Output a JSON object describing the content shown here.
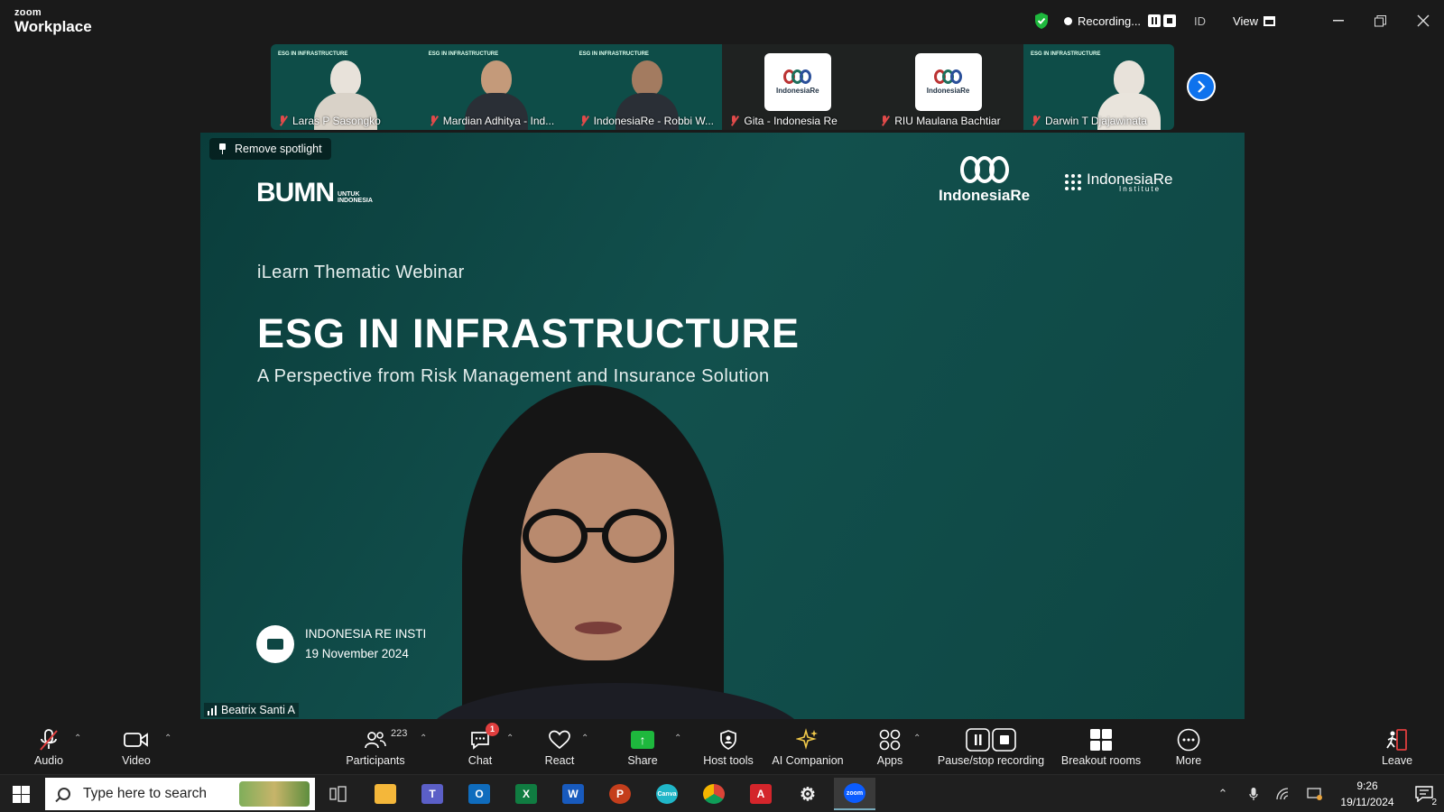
{
  "title_bar": {
    "brand_top": "zoom",
    "brand_bottom": "Workplace",
    "recording_label": "Recording...",
    "id_label": "ID",
    "view_label": "View",
    "colors": {
      "shield": "#1eb83d",
      "background": "#1a1a1a"
    }
  },
  "gallery": {
    "tiles": [
      {
        "name": "Laras P Sasongko",
        "muted": true,
        "kind": "video"
      },
      {
        "name": "Mardian Adhitya - Ind...",
        "muted": true,
        "kind": "video"
      },
      {
        "name": "IndonesiaRe - Robbi W...",
        "muted": true,
        "kind": "video"
      },
      {
        "name": "Gita - Indonesia Re",
        "muted": true,
        "kind": "logo"
      },
      {
        "name": "RIU Maulana Bachtiar",
        "muted": true,
        "kind": "logo"
      },
      {
        "name": "Darwin T Djajawinata",
        "muted": true,
        "kind": "video"
      }
    ],
    "tile_slide_text": "ESG IN INFRASTRUCTURE",
    "logo_card_text": "IndonesiaRe"
  },
  "main": {
    "spotlight_label": "Remove spotlight",
    "slide": {
      "bumn_big": "BUMN",
      "bumn_small": "UNTUK INDONESIA",
      "indonesia_re": "IndonesiaRe",
      "indonesia_re_institute": "IndonesiaRe",
      "institute_sub": "Institute",
      "webinar": "iLearn Thematic Webinar",
      "title": "ESG IN INFRASTRUCTURE",
      "subtitle": "A Perspective from Risk Management and Insurance Solution",
      "venue_line1": "INDONESIA RE INSTI",
      "venue_line2": "19 November 2024"
    },
    "speaker_name": "Beatrix Santi A",
    "colors": {
      "slide_bg": "#0e4643"
    }
  },
  "toolbar": {
    "audio": "Audio",
    "video": "Video",
    "participants": "Participants",
    "participants_count": "223",
    "chat": "Chat",
    "chat_badge": "1",
    "react": "React",
    "share": "Share",
    "host_tools": "Host tools",
    "ai_companion": "AI Companion",
    "apps": "Apps",
    "pause_stop": "Pause/stop recording",
    "breakout": "Breakout rooms",
    "more": "More",
    "leave": "Leave",
    "colors": {
      "share": "#1eb83d",
      "leave": "#e03e3e",
      "badge": "#e03e3e"
    }
  },
  "taskbar": {
    "search_placeholder": "Type here to search",
    "apps": [
      "file-explorer",
      "teams",
      "outlook",
      "excel",
      "word",
      "powerpoint",
      "canva",
      "chrome",
      "acrobat",
      "settings",
      "zoom"
    ],
    "time": "9:26",
    "date": "19/11/2024",
    "notification_count": "2"
  }
}
